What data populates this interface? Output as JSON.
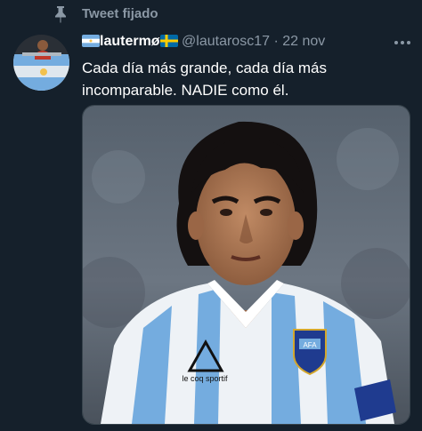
{
  "pinned": {
    "label": "Tweet fijado",
    "icon": "pin-icon"
  },
  "tweet": {
    "display_name": "lautermø",
    "handle": "@lautarosc17",
    "separator": "·",
    "date": "22 nov",
    "text_line1": "Cada día más grande, cada día más",
    "text_line2": "incomparable. NADIE como él.",
    "more_icon": "ellipsis-icon",
    "image_logo_text": "le coq sportif",
    "image_badge_text": "AFA"
  },
  "colors": {
    "background": "#15202b",
    "secondary_text": "#8b98a5",
    "primary_text": "#ffffff",
    "argentina_blue": "#74acdf"
  }
}
